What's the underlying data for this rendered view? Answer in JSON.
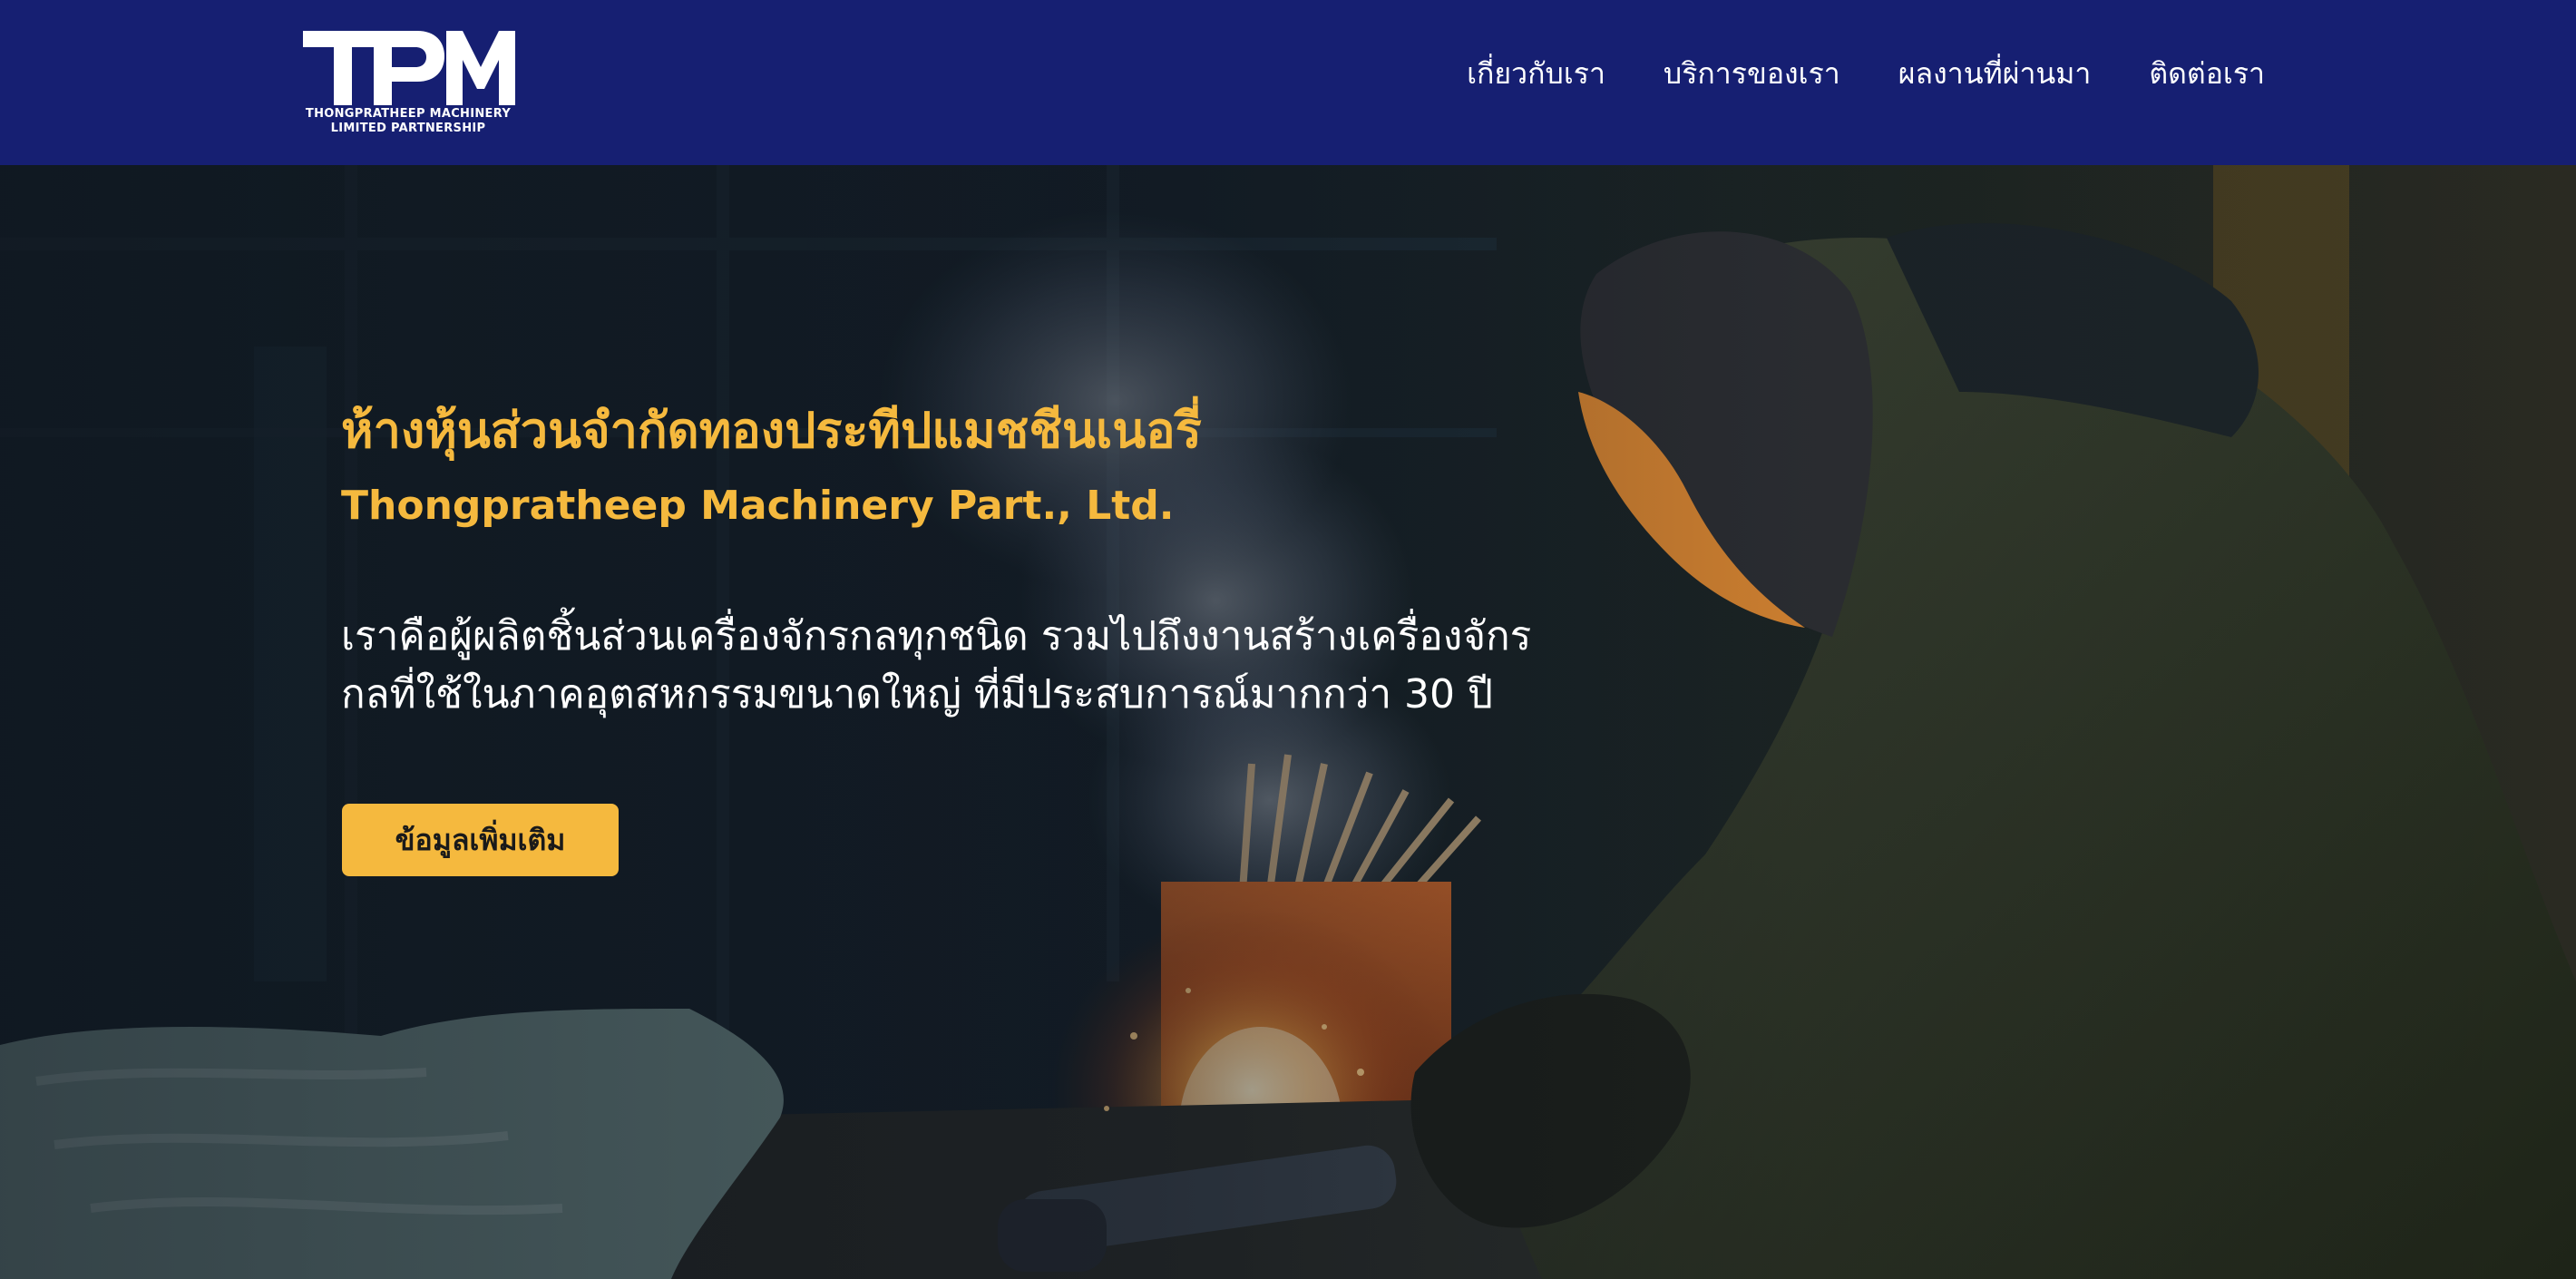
{
  "brand": {
    "logo_letters": "TPM",
    "logo_line1": "THONGPRATHEEP MACHINERY",
    "logo_line2": "LIMITED PARTNERSHIP"
  },
  "nav": {
    "items": [
      {
        "label": "เกี่ยวกับเรา"
      },
      {
        "label": "บริการของเรา"
      },
      {
        "label": "ผลงานที่ผ่านมา"
      },
      {
        "label": "ติดต่อเรา"
      }
    ]
  },
  "hero": {
    "title_th": "ห้างหุ้นส่วนจำกัดทองประทีปแมชชีนเนอรี่",
    "title_en": "Thongpratheep Machinery Part., Ltd.",
    "description_line1": "เราคือผู้ผลิตชิ้นส่วนเครื่องจักรกลทุกชนิด รวมไปถึงงานสร้างเครื่องจักร",
    "description_line2": "กลที่ใช้ในภาคอุตสหกรรมขนาดใหญ่ ที่มีประสบการณ์มากกว่า 30 ปี",
    "button_label": "ข้อมูลเพิ่มเติม"
  },
  "colors": {
    "navbar": "#161f72",
    "accent": "#f5b93e",
    "text_light": "#ffffff"
  }
}
